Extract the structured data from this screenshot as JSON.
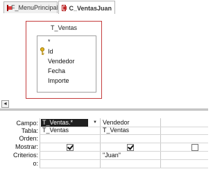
{
  "tabs": [
    {
      "label": "F_MenuPrincipal",
      "active": false
    },
    {
      "label": "C_VentasJuan",
      "active": true
    }
  ],
  "table": {
    "name": "T_Ventas",
    "fields": [
      "*",
      "Id",
      "Vendedor",
      "Fecha",
      "Importe"
    ]
  },
  "grid": {
    "row_labels": [
      "Campo:",
      "Tabla:",
      "Orden:",
      "Mostrar:",
      "Criterios:",
      "o:"
    ],
    "columns": [
      {
        "campo": "T_Ventas.*",
        "tabla": "T_Ventas",
        "orden": "",
        "mostrar": true,
        "criterios": ""
      },
      {
        "campo": "Vendedor",
        "tabla": "T_Ventas",
        "orden": "",
        "mostrar": true,
        "criterios": "\"Juan\""
      },
      {
        "campo": "",
        "tabla": "",
        "orden": "",
        "mostrar": false,
        "criterios": ""
      }
    ]
  },
  "scroll": {
    "left_arrow": "◄"
  }
}
